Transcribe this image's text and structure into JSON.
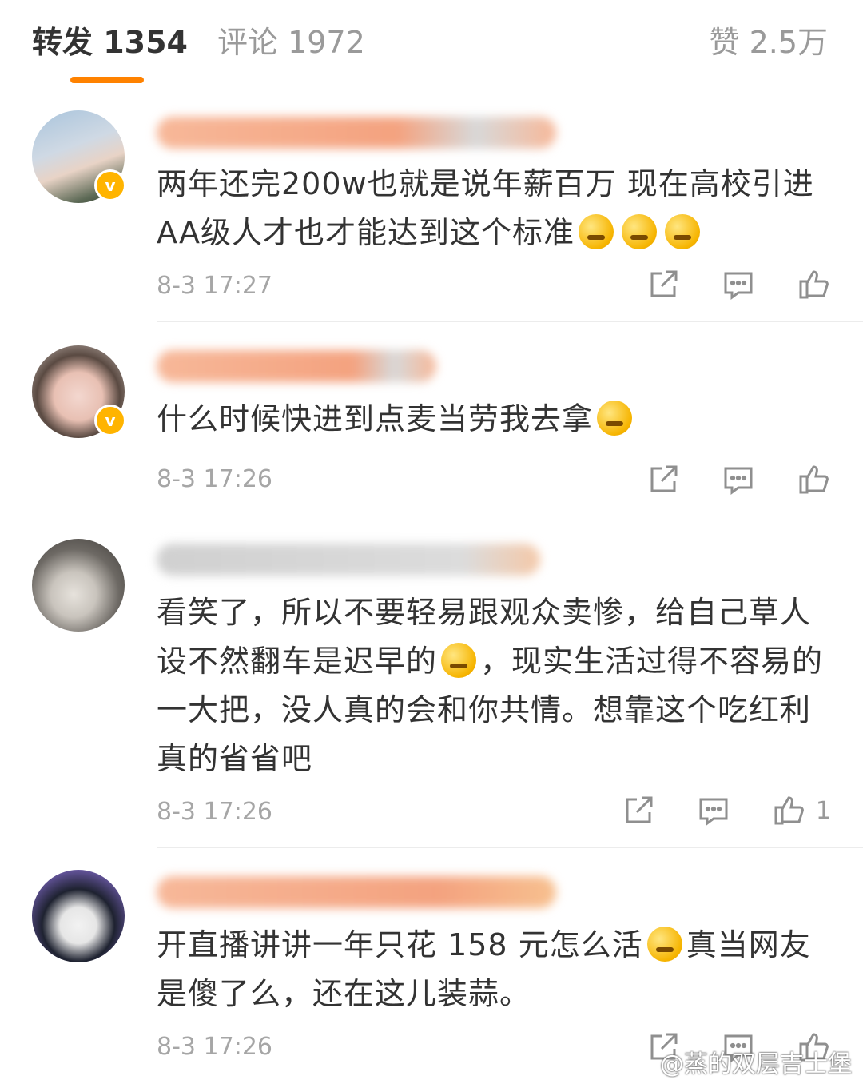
{
  "tabs": {
    "repost": "转发 1354",
    "comments": "评论 1972",
    "likes": "赞 2.5万",
    "active": "repost",
    "accent_color": "#ff8200"
  },
  "comments": [
    {
      "text": "两年还完200w也就是说年薪百万  现在高校引进AA级人才也才能达到这个标准",
      "emojis": [
        "thinking-hush-emoji",
        "thinking-hush-emoji",
        "thinking-hush-emoji"
      ],
      "time": "8-3 17:27",
      "verified": true,
      "likes": ""
    },
    {
      "text": "什么时候快进到点麦当劳我去拿",
      "emojis": [
        "tongue-out-emoji"
      ],
      "time": "8-3 17:26",
      "verified": true,
      "likes": ""
    },
    {
      "text_part1": "看笑了，所以不要轻易跟观众卖惨，给自己草人设不然翻车是迟早的",
      "text_part2": "，现实生活过得不容易的一大把，没人真的会和你共情。想靠这个吃红利真的省省吧",
      "emojis": [
        "laughing-crying-emoji"
      ],
      "time": "8-3 17:26",
      "verified": false,
      "likes": "1"
    },
    {
      "text_part1": "开直播讲讲一年只花 158 元怎么活",
      "text_part2": "真当网友是傻了么，还在这儿装蒜。",
      "emojis": [
        "grinning-emoji"
      ],
      "time": "8-3 17:26",
      "verified": false,
      "likes": ""
    }
  ],
  "verified_badge": "v",
  "watermark": "@蒸的双层吉士堡",
  "icons": [
    "share-icon",
    "comment-icon",
    "like-icon"
  ]
}
